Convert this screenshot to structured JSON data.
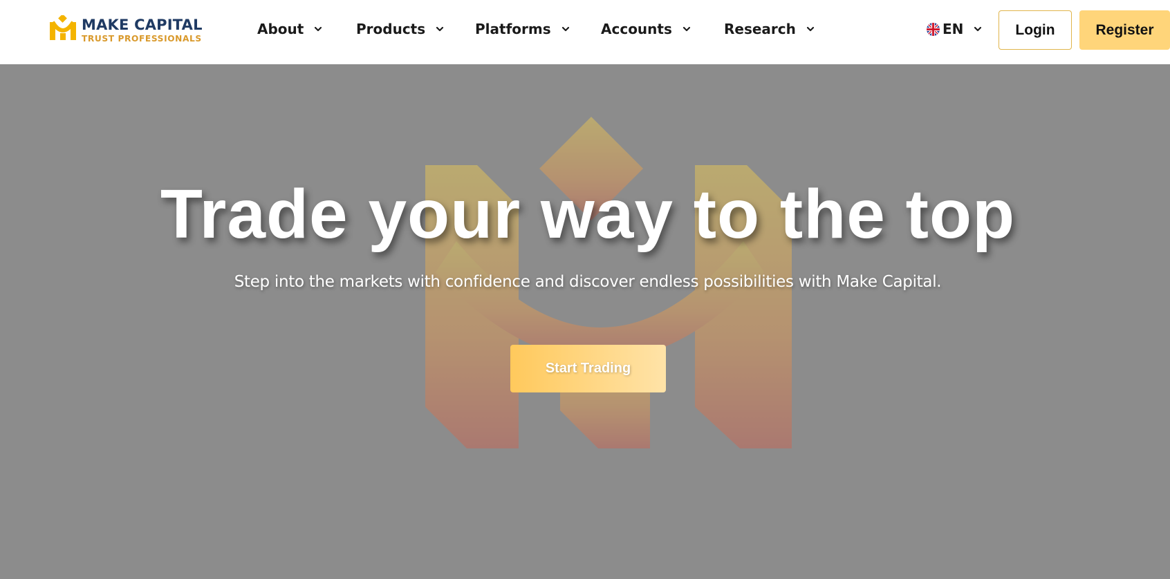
{
  "brand": {
    "name": "MAKE CAPITAL",
    "tagline": "TRUST PROFESSIONALS",
    "primary_color": "#1f3a63",
    "accent_color": "#d9992b"
  },
  "nav": {
    "items": [
      {
        "label": "About",
        "icon": "chevron-down-icon"
      },
      {
        "label": "Products",
        "icon": "chevron-down-icon"
      },
      {
        "label": "Platforms",
        "icon": "chevron-down-icon"
      },
      {
        "label": "Accounts",
        "icon": "chevron-down-icon"
      },
      {
        "label": "Research",
        "icon": "chevron-down-icon"
      }
    ],
    "language": {
      "label": "EN",
      "icon": "uk-flag-icon"
    },
    "login_label": "Login",
    "register_label": "Register",
    "register_color": "#ffd57a"
  },
  "hero": {
    "title": "Trade your way to the top",
    "subtitle": "Step into the markets with confidence and discover endless possibilities with Make Capital.",
    "cta_label": "Start Trading",
    "background_color": "#8c8c8c"
  }
}
